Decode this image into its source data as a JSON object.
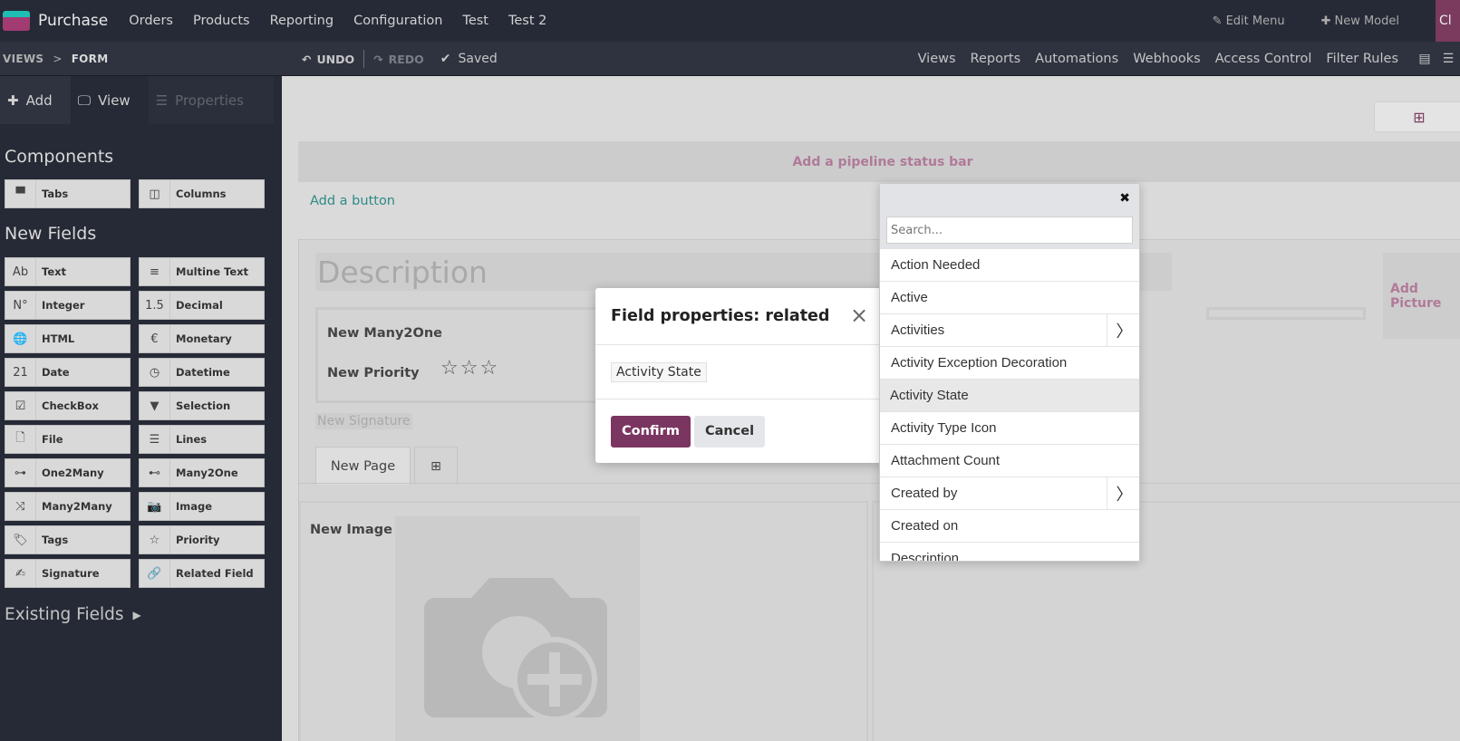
{
  "navbar": {
    "app_name": "Purchase",
    "menu": [
      "Orders",
      "Products",
      "Reporting",
      "Configuration",
      "Test",
      "Test 2"
    ],
    "edit_menu": "Edit Menu",
    "new_model": "New Model",
    "close_stub": "Cl"
  },
  "subbar": {
    "breadcrumb_root": "VIEWS",
    "breadcrumb_sep": ">",
    "breadcrumb_current": "FORM",
    "undo": "UNDO",
    "redo": "REDO",
    "saved": "Saved",
    "links": [
      "Views",
      "Reports",
      "Automations",
      "Webhooks",
      "Access Control",
      "Filter Rules"
    ]
  },
  "sidebar": {
    "tabs": {
      "add": "Add",
      "view": "View",
      "properties": "Properties"
    },
    "components_heading": "Components",
    "components": [
      {
        "label": "Tabs",
        "icon": "tabs-icon"
      },
      {
        "label": "Columns",
        "icon": "columns-icon"
      }
    ],
    "new_fields_heading": "New Fields",
    "fields": [
      {
        "label": "Text",
        "icon": "text-icon",
        "glyph": "Ab"
      },
      {
        "label": "Multine Text",
        "icon": "multiline-text-icon",
        "glyph": "≡"
      },
      {
        "label": "Integer",
        "icon": "integer-icon",
        "glyph": "N°"
      },
      {
        "label": "Decimal",
        "icon": "decimal-icon",
        "glyph": "1.5"
      },
      {
        "label": "HTML",
        "icon": "globe-icon",
        "glyph": "🌐"
      },
      {
        "label": "Monetary",
        "icon": "euro-icon",
        "glyph": "€"
      },
      {
        "label": "Date",
        "icon": "calendar-icon",
        "glyph": "21"
      },
      {
        "label": "Datetime",
        "icon": "clock-calendar-icon",
        "glyph": "◷"
      },
      {
        "label": "CheckBox",
        "icon": "checkbox-icon",
        "glyph": "☑"
      },
      {
        "label": "Selection",
        "icon": "caret-down-icon",
        "glyph": "▼"
      },
      {
        "label": "File",
        "icon": "file-icon",
        "glyph": "🗋"
      },
      {
        "label": "Lines",
        "icon": "list-icon",
        "glyph": "☰"
      },
      {
        "label": "One2Many",
        "icon": "one2many-icon",
        "glyph": "⊶"
      },
      {
        "label": "Many2One",
        "icon": "many2one-icon",
        "glyph": "⊷"
      },
      {
        "label": "Many2Many",
        "icon": "shuffle-icon",
        "glyph": "⤨"
      },
      {
        "label": "Image",
        "icon": "camera-icon",
        "glyph": "📷"
      },
      {
        "label": "Tags",
        "icon": "tag-icon",
        "glyph": "🏷"
      },
      {
        "label": "Priority",
        "icon": "star-icon",
        "glyph": "☆"
      },
      {
        "label": "Signature",
        "icon": "signature-icon",
        "glyph": "✍"
      },
      {
        "label": "Related Field",
        "icon": "link-icon",
        "glyph": "🔗"
      }
    ],
    "existing_fields": "Existing Fields"
  },
  "canvas": {
    "pipeline": "Add a pipeline status bar",
    "add_button": "Add a button",
    "description": "Description",
    "add_picture": "Add Picture",
    "many2one": "New Many2One",
    "priority": "New Priority",
    "signature": "New Signature",
    "page_tab": "New Page",
    "new_image": "New Image"
  },
  "modal": {
    "title": "Field properties: related",
    "field_value": "Activity State",
    "confirm": "Confirm",
    "cancel": "Cancel"
  },
  "picker": {
    "search_placeholder": "Search...",
    "items": [
      {
        "label": "Action Needed",
        "has_children": false
      },
      {
        "label": "Active",
        "has_children": false
      },
      {
        "label": "Activities",
        "has_children": true
      },
      {
        "label": "Activity Exception Decoration",
        "has_children": false
      },
      {
        "label": "Activity State",
        "has_children": false,
        "active": true
      },
      {
        "label": "Activity Type Icon",
        "has_children": false
      },
      {
        "label": "Attachment Count",
        "has_children": false
      },
      {
        "label": "Created by",
        "has_children": true
      },
      {
        "label": "Created on",
        "has_children": false
      },
      {
        "label": "Description",
        "has_children": false
      }
    ]
  },
  "colors": {
    "brand": "#7b3561",
    "teal": "#2e8b84"
  }
}
